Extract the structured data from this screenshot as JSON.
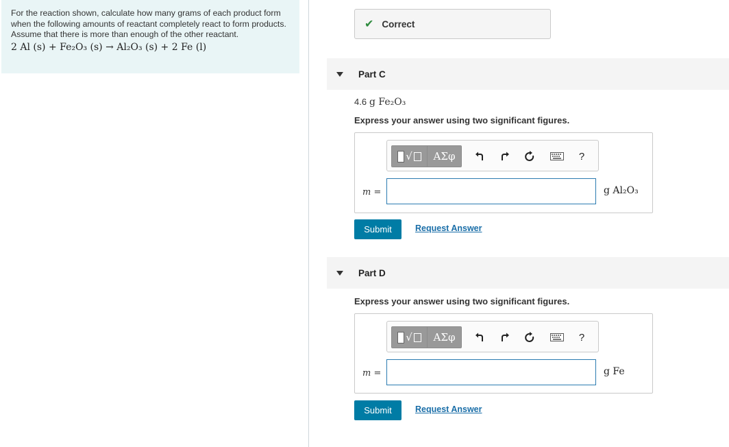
{
  "problem": {
    "text": "For the reaction shown, calculate how many grams of each product form when the following amounts of reactant completely react to form products. Assume that there is more than enough of the other reactant.",
    "equation": "2 Al (s) + Fe₂O₃ (s) → Al₂O₃ (s) + 2 Fe (l)"
  },
  "feedback": {
    "status": "Correct"
  },
  "part_c": {
    "title": "Part C",
    "given_amount": "4.6",
    "given_unit": "g Fe₂O₃",
    "instruction": "Express your answer using two significant figures.",
    "label": "m",
    "equals": "=",
    "input_value": "",
    "unit": "g Al₂O₃",
    "submit_label": "Submit",
    "request_label": "Request Answer"
  },
  "part_d": {
    "title": "Part D",
    "instruction": "Express your answer using two significant figures.",
    "label": "m",
    "equals": "=",
    "input_value": "",
    "unit": "g Fe",
    "submit_label": "Submit",
    "request_label": "Request Answer"
  },
  "toolbar": {
    "greek_label": "ΑΣφ",
    "help_label": "?",
    "icons": [
      "templates-icon",
      "greek-symbols-icon",
      "undo-icon",
      "redo-icon",
      "reset-icon",
      "keyboard-icon",
      "help-icon"
    ]
  },
  "colors": {
    "accent": "#007ca5",
    "link": "#1a6ea8",
    "correct": "#2e8b3e",
    "problem_bg": "#e9f5f6"
  }
}
